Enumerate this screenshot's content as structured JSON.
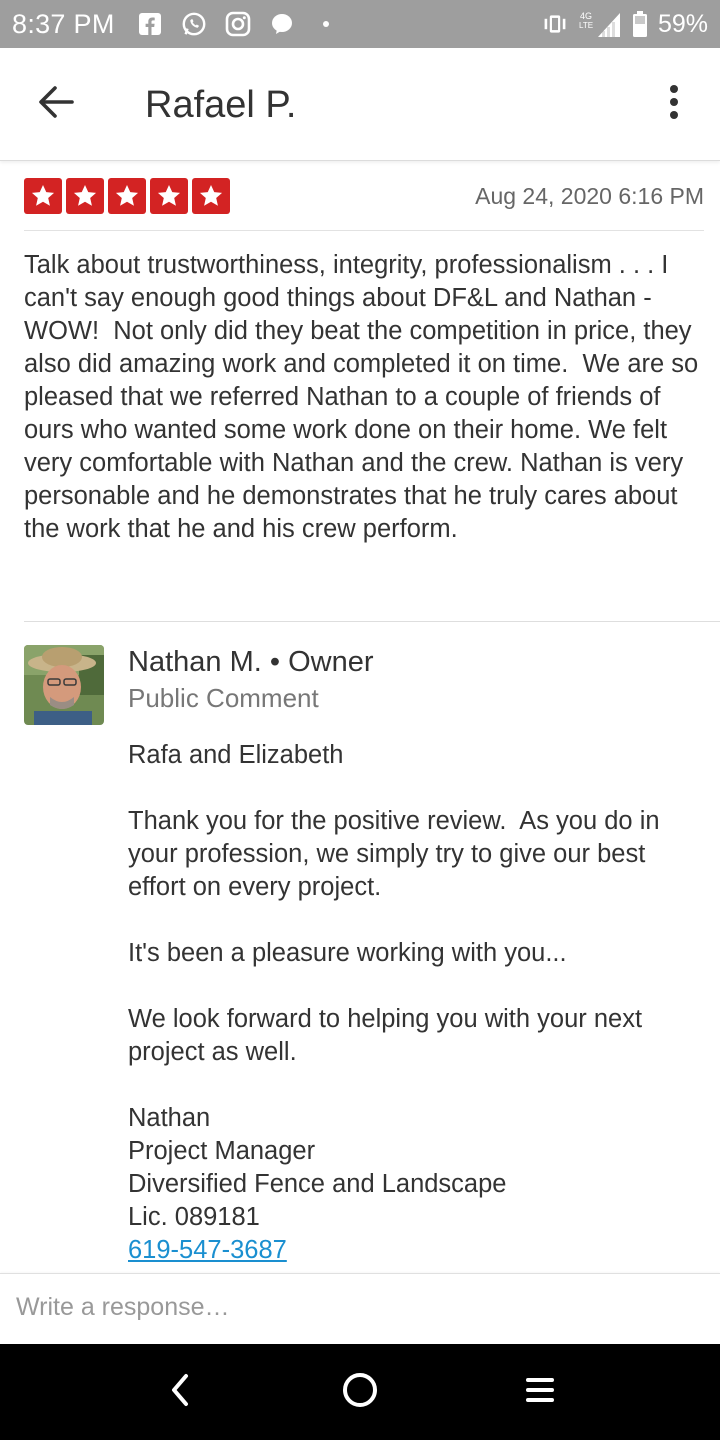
{
  "status_bar": {
    "time": "8:37 PM",
    "battery": "59%",
    "network_label": "4G LTE",
    "icons": [
      "facebook-icon",
      "whatsapp-icon",
      "instagram-icon",
      "messenger-icon",
      "dot-icon",
      "vibrate-icon",
      "signal-icon",
      "battery-icon"
    ]
  },
  "app_bar": {
    "title": "Rafael P.",
    "back_icon": "arrow-back-icon",
    "more_icon": "more-vert-icon"
  },
  "review": {
    "rating": 5,
    "rating_color": "#d32323",
    "date": "Aug 24, 2020 6:16 PM",
    "text": "Talk about trustworthiness, integrity, professionalism . . . I can't say enough good things about DF&L and Nathan - WOW!  Not only did they beat the competition in price, they also did amazing work and completed it on time.  We are so pleased that we referred Nathan to a couple of friends of ours who wanted some work done on their home. We felt very comfortable with Nathan and the crew. Nathan is very personable and he demonstrates that he truly cares about the work that he and his crew perform."
  },
  "owner_comment": {
    "name": "Nathan M.",
    "role": "Owner",
    "separator": "•",
    "type": "Public Comment",
    "greeting": "Rafa and Elizabeth",
    "para1": "Thank you for the positive review.  As you do in your profession, we simply try to give our best effort on every project.",
    "para2": "It's been a pleasure working with you...",
    "para3": "We look forward to helping you with your next project as well.",
    "signature_name": "Nathan",
    "signature_title": "Project Manager",
    "company": "Diversified Fence and Landscape",
    "license": "Lic. 089181",
    "phone": "619-547-3687",
    "link_color": "#1a8fd0"
  },
  "response": {
    "placeholder": "Write a response…"
  },
  "nav": {
    "back_icon": "nav-back-icon",
    "home_icon": "nav-home-icon",
    "menu_icon": "nav-menu-icon"
  }
}
